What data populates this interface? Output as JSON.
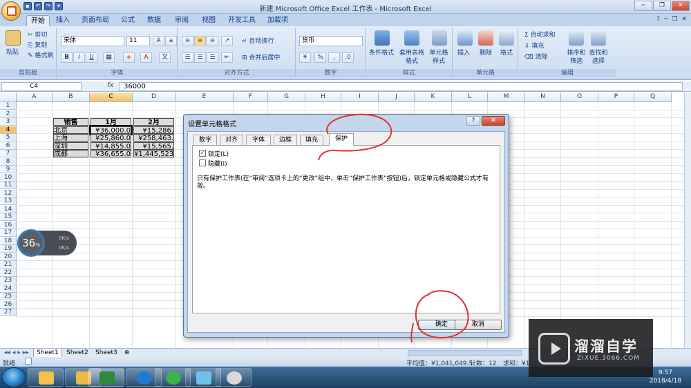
{
  "window": {
    "title": "新建 Microsoft Office Excel 工作表 - Microsoft Excel"
  },
  "tabs": [
    "开始",
    "插入",
    "页面布局",
    "公式",
    "数据",
    "审阅",
    "视图",
    "开发工具",
    "加载项"
  ],
  "ribbon": {
    "clipboard": {
      "paste": "粘贴",
      "cut": "剪切",
      "copy": "复制",
      "format_painter": "格式刷",
      "label": "剪贴板"
    },
    "font": {
      "name": "宋体",
      "size": "11",
      "label": "字体"
    },
    "alignment": {
      "wrap": "自动换行",
      "merge": "合并后居中",
      "label": "对齐方式"
    },
    "number": {
      "format": "货币",
      "label": "数字"
    },
    "styles": {
      "conditional": "条件格式",
      "table": "套用表格格式",
      "cell": "单元格样式",
      "label": "样式"
    },
    "cells": {
      "insert": "插入",
      "delete": "删除",
      "format": "格式",
      "label": "单元格"
    },
    "editing": {
      "autosum": "自动求和",
      "fill": "填充",
      "clear": "清除",
      "sort": "排序和筛选",
      "find": "查找和选择",
      "label": "编辑"
    }
  },
  "formula_bar": {
    "name_box": "C4",
    "fx": "fx",
    "formula": "36000"
  },
  "columns": [
    "A",
    "B",
    "C",
    "D",
    "E",
    "F",
    "G",
    "H",
    "I",
    "J",
    "K",
    "L",
    "M",
    "N",
    "O",
    "P",
    "Q"
  ],
  "rows": [
    "1",
    "2",
    "3",
    "4",
    "5",
    "6",
    "7",
    "8",
    "9",
    "10",
    "11",
    "12",
    "13",
    "14",
    "15",
    "16",
    "17",
    "18",
    "19",
    "20",
    "21",
    "22",
    "23",
    "24",
    "25",
    "26",
    "27"
  ],
  "table": {
    "headers": [
      "销售",
      "1月",
      "2月"
    ],
    "rows": [
      [
        "北京",
        "¥36,000.0",
        "¥15,286."
      ],
      [
        "上海",
        "¥25,860.0",
        "¥258,463."
      ],
      [
        "深圳",
        "¥14,855.0",
        "¥15,565."
      ],
      [
        "成都",
        "¥36,655.0",
        "¥1,445,523."
      ]
    ]
  },
  "gauge": {
    "percent": "36",
    "unit": "%",
    "up": "0K/s",
    "down": "0K/s"
  },
  "dialog": {
    "title": "设置单元格格式",
    "help": "?",
    "close": "✕",
    "tabs": [
      "数字",
      "对齐",
      "字体",
      "边框",
      "填充",
      "保护"
    ],
    "active_tab": "保护",
    "locked": {
      "label": "锁定(L)",
      "checked": true
    },
    "hidden": {
      "label": "隐藏(I)",
      "checked": false
    },
    "note": "只有保护工作表(在“审阅”选项卡上的“更改”组中，单击“保护工作表”按钮)后，锁定单元格或隐藏公式才有效。",
    "ok": "确定",
    "cancel": "取消"
  },
  "sheets": [
    "Sheet1",
    "Sheet2",
    "Sheet3"
  ],
  "status": {
    "ready": "就绪",
    "average": "平均值：¥1,041,049.5",
    "count": "计数：12",
    "sum": "求和：¥1"
  },
  "clock": {
    "time": "9:57",
    "date": "2018/4/18"
  },
  "watermark": {
    "title": "溜溜自学",
    "url": "ZIXUE.3066.COM"
  }
}
